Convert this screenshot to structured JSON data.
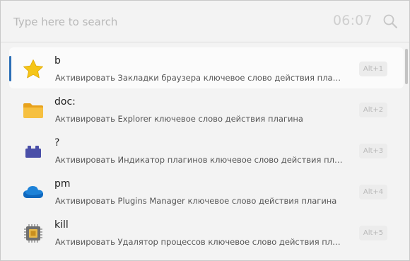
{
  "search": {
    "placeholder": "Type here to search",
    "value": ""
  },
  "clock": "06:07",
  "icons": {
    "search": "search-icon"
  },
  "results": [
    {
      "title": "b",
      "subtitle": "Активировать Закладки браузера ключевое слово действия плагина",
      "hotkey": "Alt+1",
      "icon": "star-icon",
      "selected": true
    },
    {
      "title": "doc:",
      "subtitle": "Активировать Explorer ключевое слово действия плагина",
      "hotkey": "Alt+2",
      "icon": "folder-icon",
      "selected": false
    },
    {
      "title": "?",
      "subtitle": "Активировать Индикатор плагинов ключевое слово действия плагина",
      "hotkey": "Alt+3",
      "icon": "plugin-block-icon",
      "selected": false
    },
    {
      "title": "pm",
      "subtitle": "Активировать Plugins Manager ключевое слово действия плагина",
      "hotkey": "Alt+4",
      "icon": "cloud-icon",
      "selected": false
    },
    {
      "title": "kill",
      "subtitle": "Активировать Удалятор процессов ключевое слово действия плагина",
      "hotkey": "Alt+5",
      "icon": "cpu-chip-icon",
      "selected": false
    }
  ],
  "colors": {
    "accent": "#2c6fb7",
    "background": "#f3f3f3",
    "selected_row": "#fbfbfb",
    "star": "#f5c518",
    "folder": "#f3b531",
    "plugin": "#4a4fa8",
    "cloud": "#1d82d8"
  }
}
